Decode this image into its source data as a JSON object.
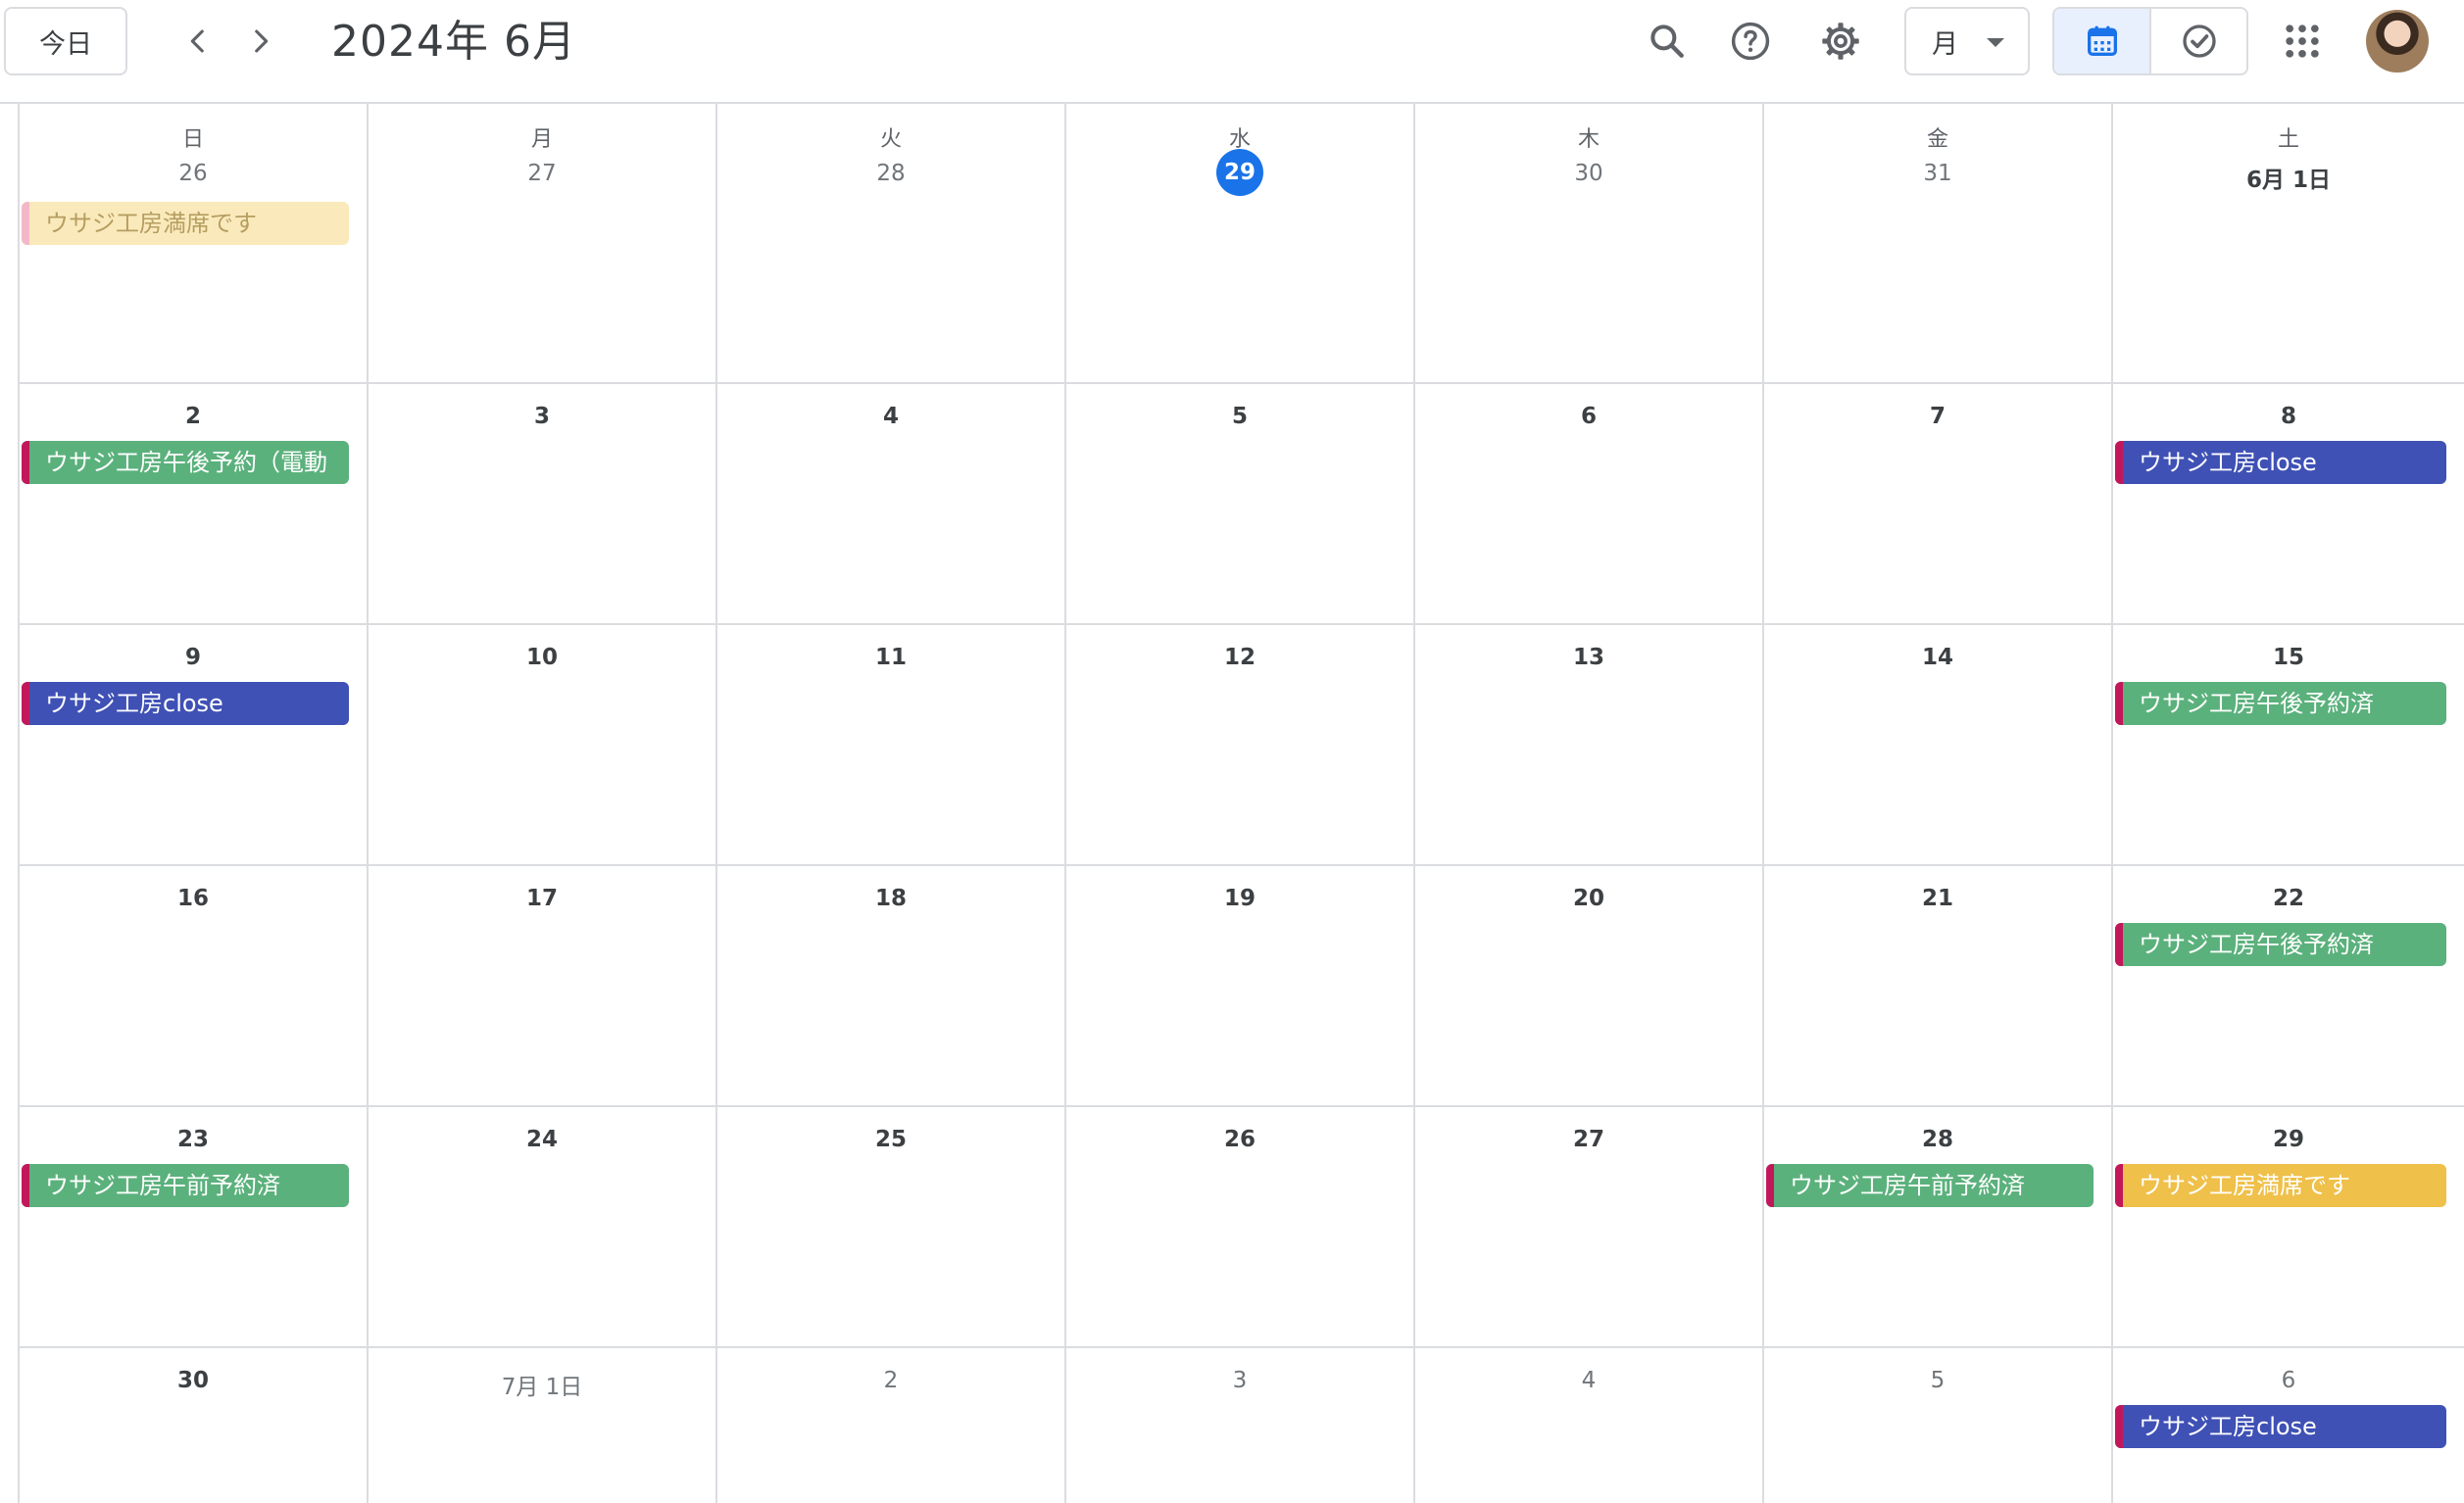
{
  "header": {
    "today_label": "今日",
    "title": "2024年 6月",
    "view_label": "月"
  },
  "colors": {
    "accent": "#1a73e8",
    "event_green": "#5bb17c",
    "event_blue": "#3f51b5",
    "event_yellow": "#efc04a",
    "event_pale": "#faeabb",
    "event_stripe": "#c2185b"
  },
  "weekdays": [
    "日",
    "月",
    "火",
    "水",
    "木",
    "金",
    "土"
  ],
  "weeks": [
    [
      {
        "date": "26",
        "muted": true,
        "events": [
          {
            "title": "ウサジ工房満席です",
            "color": "pale"
          }
        ]
      },
      {
        "date": "27",
        "muted": true,
        "events": []
      },
      {
        "date": "28",
        "muted": true,
        "events": []
      },
      {
        "date": "29",
        "muted": false,
        "today": true,
        "events": []
      },
      {
        "date": "30",
        "muted": true,
        "events": []
      },
      {
        "date": "31",
        "muted": true,
        "events": []
      },
      {
        "date": "6月 1日",
        "muted": false,
        "events": []
      }
    ],
    [
      {
        "date": "2",
        "events": [
          {
            "title": "ウサジ工房午後予約（電動",
            "color": "green"
          }
        ]
      },
      {
        "date": "3",
        "events": []
      },
      {
        "date": "4",
        "events": []
      },
      {
        "date": "5",
        "events": []
      },
      {
        "date": "6",
        "events": []
      },
      {
        "date": "7",
        "events": []
      },
      {
        "date": "8",
        "events": [
          {
            "title": "ウサジ工房close",
            "color": "blue"
          }
        ]
      }
    ],
    [
      {
        "date": "9",
        "events": [
          {
            "title": "ウサジ工房close",
            "color": "blue"
          }
        ]
      },
      {
        "date": "10",
        "events": []
      },
      {
        "date": "11",
        "events": []
      },
      {
        "date": "12",
        "events": []
      },
      {
        "date": "13",
        "events": []
      },
      {
        "date": "14",
        "events": []
      },
      {
        "date": "15",
        "events": [
          {
            "title": "ウサジ工房午後予約済",
            "color": "green"
          }
        ]
      }
    ],
    [
      {
        "date": "16",
        "events": []
      },
      {
        "date": "17",
        "events": []
      },
      {
        "date": "18",
        "events": []
      },
      {
        "date": "19",
        "events": []
      },
      {
        "date": "20",
        "events": []
      },
      {
        "date": "21",
        "events": []
      },
      {
        "date": "22",
        "events": [
          {
            "title": "ウサジ工房午後予約済",
            "color": "green"
          }
        ]
      }
    ],
    [
      {
        "date": "23",
        "events": [
          {
            "title": "ウサジ工房午前予約済",
            "color": "green"
          }
        ]
      },
      {
        "date": "24",
        "events": []
      },
      {
        "date": "25",
        "events": []
      },
      {
        "date": "26",
        "events": []
      },
      {
        "date": "27",
        "events": []
      },
      {
        "date": "28",
        "events": [
          {
            "title": "ウサジ工房午前予約済",
            "color": "green"
          }
        ]
      },
      {
        "date": "29",
        "events": [
          {
            "title": "ウサジ工房満席です",
            "color": "yellow"
          }
        ]
      }
    ],
    [
      {
        "date": "30",
        "events": []
      },
      {
        "date": "7月 1日",
        "muted": true,
        "events": []
      },
      {
        "date": "2",
        "muted": true,
        "events": []
      },
      {
        "date": "3",
        "muted": true,
        "events": []
      },
      {
        "date": "4",
        "muted": true,
        "events": []
      },
      {
        "date": "5",
        "muted": true,
        "events": []
      },
      {
        "date": "6",
        "muted": true,
        "events": [
          {
            "title": "ウサジ工房close",
            "color": "blue"
          }
        ]
      }
    ]
  ]
}
